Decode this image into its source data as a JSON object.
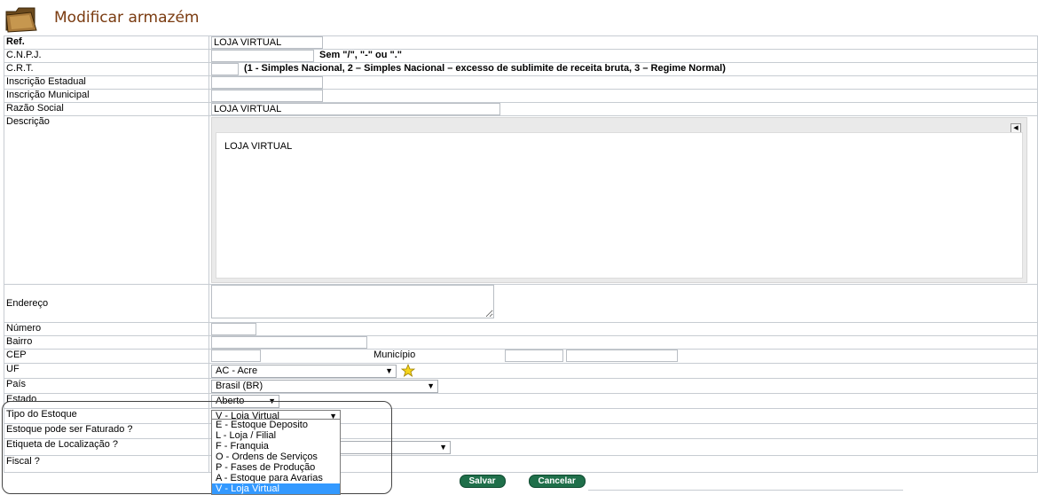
{
  "header": {
    "title": "Modificar armazém",
    "icon": "folder-icon"
  },
  "fields": {
    "ref": {
      "label": "Ref.",
      "value": "LOJA VIRTUAL"
    },
    "cnpj": {
      "label": "C.N.P.J.",
      "value": "",
      "hint": "Sem \"/\", \"-\" ou \".\""
    },
    "crt": {
      "label": "C.R.T.",
      "value": "",
      "hint": "(1 - Simples Nacional, 2 – Simples Nacional – excesso de sublimite de receita bruta, 3 – Regime Normal)"
    },
    "inscricao_estadual": {
      "label": "Inscrição Estadual",
      "value": ""
    },
    "inscricao_municipal": {
      "label": "Inscrição Municipal",
      "value": ""
    },
    "razao_social": {
      "label": "Razão Social",
      "value": "LOJA VIRTUAL"
    },
    "descricao": {
      "label": "Descrição",
      "value": "LOJA VIRTUAL"
    },
    "endereco": {
      "label": "Endereço",
      "value": ""
    },
    "numero": {
      "label": "Número",
      "value": ""
    },
    "bairro": {
      "label": "Bairro",
      "value": ""
    },
    "cep": {
      "label": "CEP",
      "value": ""
    },
    "municipio": {
      "label": "Município",
      "value": "",
      "value2": ""
    },
    "uf": {
      "label": "UF",
      "selected": "AC - Acre"
    },
    "pais": {
      "label": "País",
      "selected": "Brasil (BR)"
    },
    "estado": {
      "label": "Estado",
      "selected": "Aberto"
    },
    "tipo_estoque": {
      "label": "Tipo do Estoque",
      "selected": "V - Loja Virtual",
      "options": [
        "E - Estoque Deposito",
        "L - Loja / Filial",
        "F - Franquia",
        "O - Ordens de Serviços",
        "P - Fases de Produção",
        "A - Estoque para Avarias",
        "V - Loja Virtual"
      ]
    },
    "estoque_faturado": {
      "label": "Estoque pode ser Faturado ?"
    },
    "etiqueta": {
      "label": "Etiqueta de Localização ?",
      "selected": ""
    },
    "fiscal": {
      "label": "Fiscal ?"
    }
  },
  "buttons": {
    "save": "Salvar",
    "cancel": "Cancelar"
  },
  "colors": {
    "title": "#7a3b10",
    "button": "#1f6f4a",
    "dropdown_selected": "#3399ff"
  }
}
